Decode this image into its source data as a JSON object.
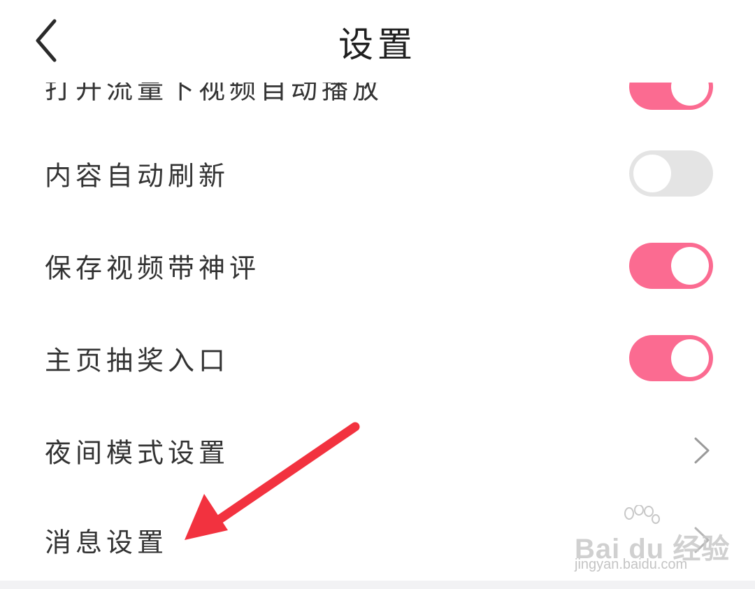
{
  "header": {
    "title": "设置",
    "back_icon": "chevron-left-icon"
  },
  "settings": {
    "partial_item": {
      "label": "打开流量下视频自动播放",
      "state": "on"
    },
    "items": [
      {
        "label": "内容自动刷新",
        "control": "toggle",
        "state": "off"
      },
      {
        "label": "保存视频带神评",
        "control": "toggle",
        "state": "on"
      },
      {
        "label": "主页抽奖入口",
        "control": "toggle",
        "state": "on"
      },
      {
        "label": "夜间模式设置",
        "control": "chevron",
        "icon": "chevron-right-icon"
      },
      {
        "label": "消息设置",
        "control": "chevron",
        "icon": "chevron-right-icon"
      }
    ]
  },
  "watermark": {
    "brand": "Bai du 经验",
    "url": "jingyan.baidu.com"
  },
  "colors": {
    "toggle_on": "#fb6b91",
    "toggle_off": "#e4e4e4",
    "annotation_arrow": "#f2323f"
  }
}
